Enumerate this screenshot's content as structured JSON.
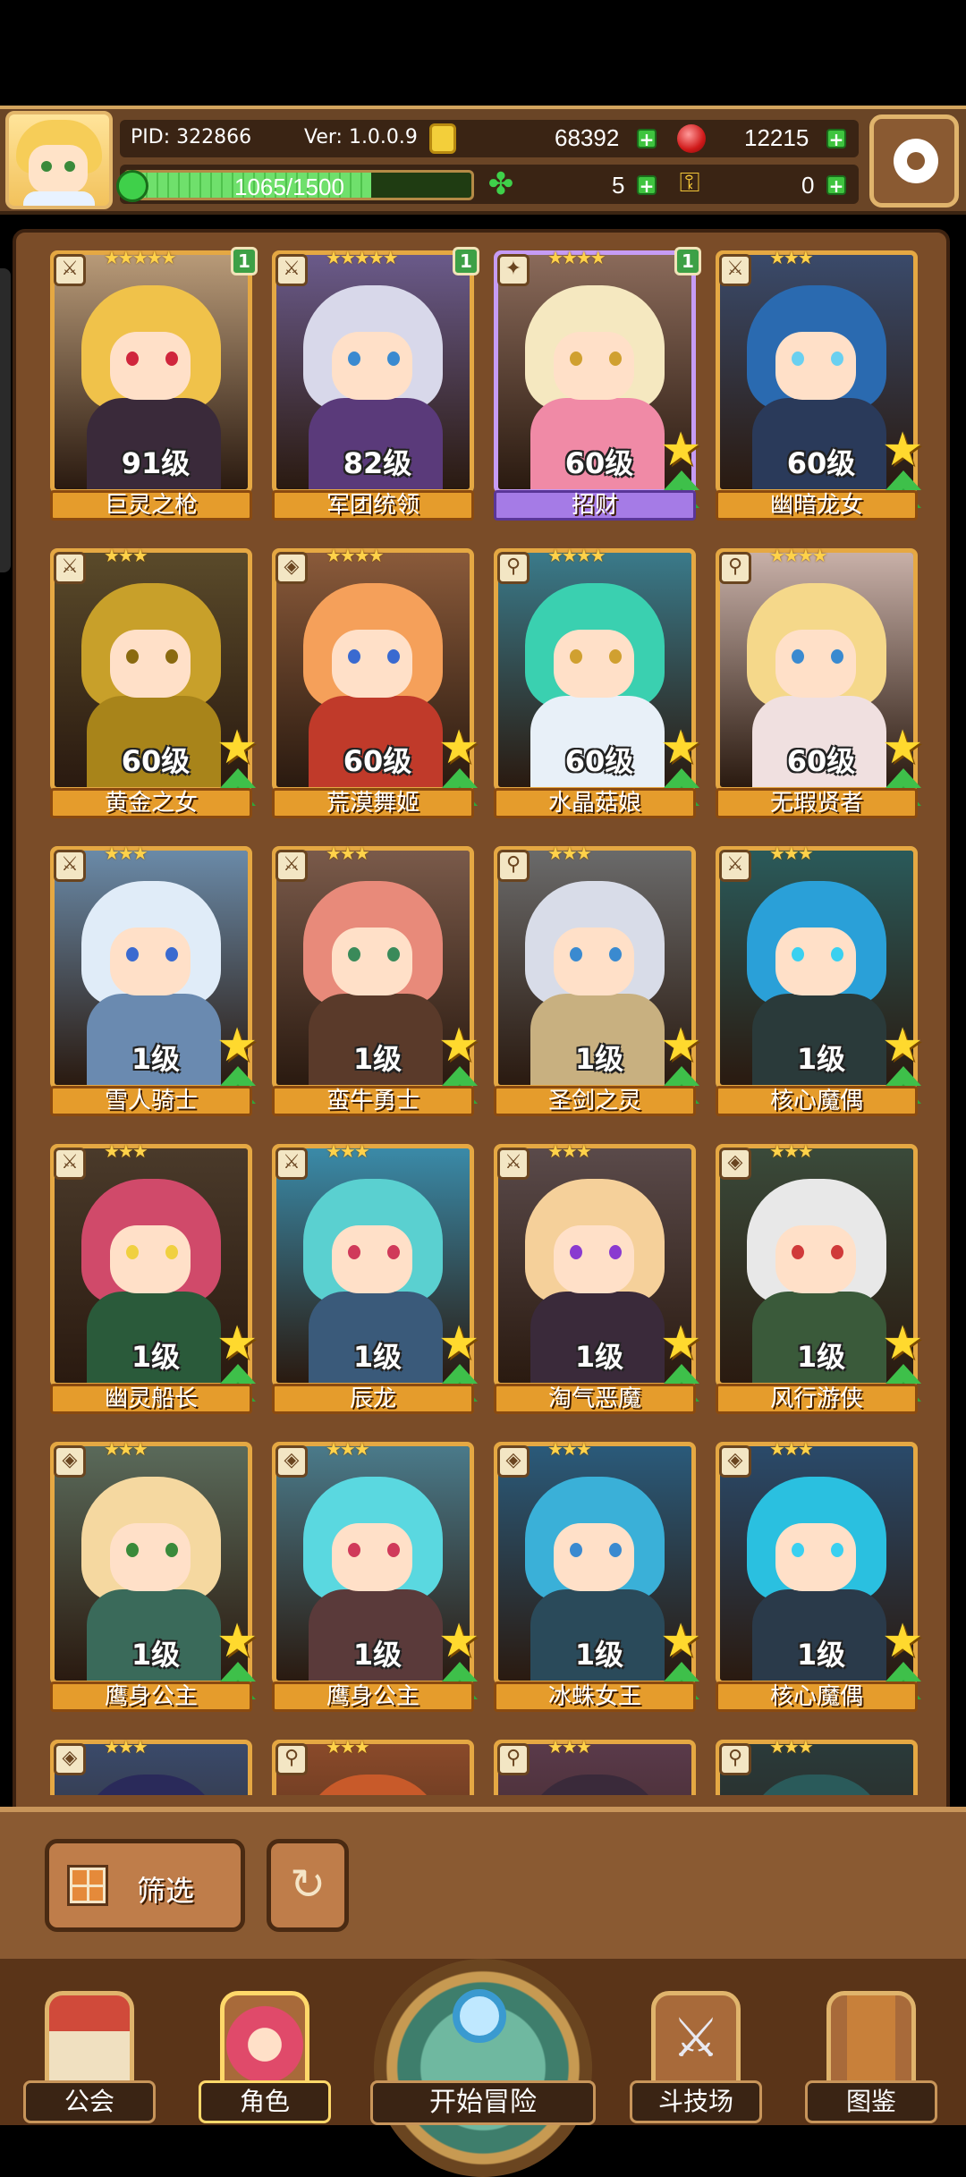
{
  "header": {
    "pid": "PID: 322866",
    "version": "Ver: 1.0.0.9",
    "gold": "68392",
    "gems": "12215",
    "xp": "1065/1500",
    "xp_progress": 0.71,
    "clover_count": "5",
    "key_count": "0",
    "plus": "+"
  },
  "cards": [
    {
      "level": "91级",
      "name": "巨灵之枪",
      "stars": "★★★★★",
      "badge": "1",
      "hair": "#f0c24a",
      "body": "#3a2a3a",
      "eye": "#d0263c",
      "bg": "#b89a78",
      "purple": false,
      "class_icon": "⚔"
    },
    {
      "level": "82级",
      "name": "军团统领",
      "stars": "★★★★★",
      "badge": "1",
      "hair": "#d8d8ea",
      "body": "#5a3a7a",
      "eye": "#3a8ad0",
      "bg": "#6a5a8a",
      "purple": false,
      "class_icon": "⚔"
    },
    {
      "level": "60级",
      "name": "招财",
      "stars": "★★★★",
      "badge": "1",
      "hair": "#f5e8c0",
      "body": "#f08aa6",
      "eye": "#d0a030",
      "bg": "#8a6a5a",
      "purple": true,
      "class_icon": "✦"
    },
    {
      "level": "60级",
      "name": "幽暗龙女",
      "stars": "★★★",
      "badge": "",
      "hair": "#2a6ab0",
      "body": "#2a3a5a",
      "eye": "#6ad0f0",
      "bg": "#3a4a6a",
      "purple": false,
      "class_icon": "⚔"
    },
    {
      "level": "60级",
      "name": "黄金之女",
      "stars": "★★★",
      "badge": "",
      "hair": "#c8a02a",
      "body": "#a8841a",
      "eye": "#8a6a10",
      "bg": "#5a4a2a",
      "purple": false,
      "class_icon": "⚔"
    },
    {
      "level": "60级",
      "name": "荒漠舞姬",
      "stars": "★★★★",
      "badge": "",
      "hair": "#f5a05a",
      "body": "#c03a2a",
      "eye": "#3a6ad0",
      "bg": "#8a5a3a",
      "purple": false,
      "class_icon": "◈"
    },
    {
      "level": "60级",
      "name": "水晶菇娘",
      "stars": "★★★★",
      "badge": "",
      "hair": "#3ad0b0",
      "body": "#e8f0f8",
      "eye": "#d0a030",
      "bg": "#3a7a8a",
      "purple": false,
      "class_icon": "⚲"
    },
    {
      "level": "60级",
      "name": "无瑕贤者",
      "stars": "★★★★",
      "badge": "",
      "hair": "#f5d88a",
      "body": "#f0e0e0",
      "eye": "#3a8ad0",
      "bg": "#c8b0a8",
      "purple": false,
      "class_icon": "⚲"
    },
    {
      "level": "1级",
      "name": "雪人骑士",
      "stars": "★★★",
      "badge": "",
      "hair": "#e0ecf8",
      "body": "#6a8ab0",
      "eye": "#3a6ad0",
      "bg": "#6a8aa8",
      "purple": false,
      "class_icon": "⚔"
    },
    {
      "level": "1级",
      "name": "蛮牛勇士",
      "stars": "★★★",
      "badge": "",
      "hair": "#e88a7a",
      "body": "#5a3a2a",
      "eye": "#3a8a5a",
      "bg": "#7a5a4a",
      "purple": false,
      "class_icon": "⚔"
    },
    {
      "level": "1级",
      "name": "圣剑之灵",
      "stars": "★★★",
      "badge": "",
      "hair": "#d8dce8",
      "body": "#c8b080",
      "eye": "#3a8ad0",
      "bg": "#6a6a6a",
      "purple": false,
      "class_icon": "⚲"
    },
    {
      "level": "1级",
      "name": "核心魔偶",
      "stars": "★★★",
      "badge": "",
      "hair": "#2aa0d8",
      "body": "#2a3a3a",
      "eye": "#3ad0f0",
      "bg": "#2a5a5a",
      "purple": false,
      "class_icon": "⚔"
    },
    {
      "level": "1级",
      "name": "幽灵船长",
      "stars": "★★★",
      "badge": "",
      "hair": "#d04a6a",
      "body": "#2a5a3a",
      "eye": "#f0d040",
      "bg": "#4a3a2a",
      "purple": false,
      "class_icon": "⚔"
    },
    {
      "level": "1级",
      "name": "辰龙",
      "stars": "★★★",
      "badge": "",
      "hair": "#5ad0d0",
      "body": "#3a5a7a",
      "eye": "#d03a5a",
      "bg": "#3a8aa8",
      "purple": false,
      "class_icon": "⚔"
    },
    {
      "level": "1级",
      "name": "淘气恶魔",
      "stars": "★★★",
      "badge": "",
      "hair": "#f5d09a",
      "body": "#3a2a3a",
      "eye": "#8a3ad0",
      "bg": "#5a4a4a",
      "purple": false,
      "class_icon": "⚔"
    },
    {
      "level": "1级",
      "name": "风行游侠",
      "stars": "★★★",
      "badge": "",
      "hair": "#e8e8e8",
      "body": "#3a5a3a",
      "eye": "#d03a3a",
      "bg": "#3a4a3a",
      "purple": false,
      "class_icon": "◈"
    },
    {
      "level": "1级",
      "name": "鹰身公主",
      "stars": "★★★",
      "badge": "",
      "hair": "#f5d8a0",
      "body": "#3a6a5a",
      "eye": "#3a8a3a",
      "bg": "#5a6a5a",
      "purple": false,
      "class_icon": "◈"
    },
    {
      "level": "1级",
      "name": "鹰身公主",
      "stars": "★★★",
      "badge": "",
      "hair": "#5ad8e0",
      "body": "#5a3a3a",
      "eye": "#d03a5a",
      "bg": "#4a7a8a",
      "purple": false,
      "class_icon": "◈"
    },
    {
      "level": "1级",
      "name": "冰蛛女王",
      "stars": "★★★",
      "badge": "",
      "hair": "#3ab0d8",
      "body": "#2a4a5a",
      "eye": "#3a8ad0",
      "bg": "#2a5a7a",
      "purple": false,
      "class_icon": "◈"
    },
    {
      "level": "1级",
      "name": "核心魔偶",
      "stars": "★★★",
      "badge": "",
      "hair": "#2ac0e0",
      "body": "#2a3a4a",
      "eye": "#3ad0f0",
      "bg": "#2a4a6a",
      "purple": false,
      "class_icon": "◈"
    }
  ],
  "partial_cards": [
    {
      "stars": "★★★",
      "hair": "#2a2a5a",
      "bg": "#3a4a6a",
      "class_icon": "◈"
    },
    {
      "stars": "★★★",
      "hair": "#c85a2a",
      "bg": "#8a4a2a",
      "class_icon": "⚲"
    },
    {
      "stars": "★★★",
      "hair": "#3a2a3a",
      "bg": "#5a3a4a",
      "class_icon": "⚲"
    },
    {
      "stars": "★★★",
      "hair": "#2a5a5a",
      "bg": "#2a3a3a",
      "class_icon": "⚲"
    }
  ],
  "filter": {
    "label": "筛选",
    "reset_icon": "↻"
  },
  "nav": {
    "guild": "公会",
    "roles": "角色",
    "adventure": "开始冒险",
    "arena": "斗技场",
    "codex": "图鉴"
  }
}
